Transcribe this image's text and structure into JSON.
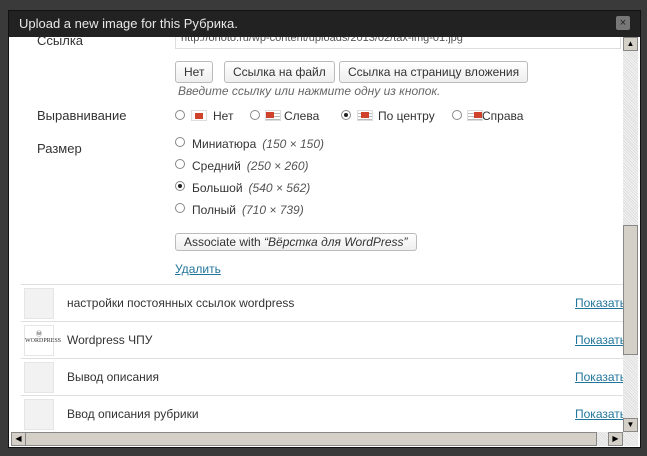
{
  "dialog": {
    "title": "Upload a new image for this Рубрика.",
    "close_icon": "×"
  },
  "link": {
    "label": "Ссылка",
    "url": "http://onoto.ru/wp-content/uploads/2013/02/tax-img-01.jpg",
    "buttons": [
      "Нет",
      "Ссылка на файл",
      "Ссылка на страницу вложения"
    ],
    "hint": "Введите ссылку или нажмите одну из кнопок."
  },
  "align": {
    "label": "Выравнивание",
    "options": [
      {
        "label": "Нет",
        "checked": false
      },
      {
        "label": "Слева",
        "checked": false
      },
      {
        "label": "По центру",
        "checked": true
      },
      {
        "label": "Справа",
        "checked": false
      }
    ]
  },
  "size": {
    "label": "Размер",
    "options": [
      {
        "label": "Миниатюра",
        "dim": "(150 × 150)",
        "checked": false
      },
      {
        "label": "Средний",
        "dim": "(250 × 260)",
        "checked": false
      },
      {
        "label": "Большой",
        "dim": "(540 × 562)",
        "checked": true
      },
      {
        "label": "Полный",
        "dim": "(710 × 739)",
        "checked": false
      }
    ]
  },
  "associate": {
    "prefix": "Associate with ",
    "name": "“Вёрстка для WordPress”"
  },
  "delete_label": "Удалить",
  "items": [
    {
      "title": "настройки постоянных ссылок wordpress",
      "action": "Показать"
    },
    {
      "title": "Wordpress ЧПУ",
      "action": "Показать"
    },
    {
      "title": "Вывод описания",
      "action": "Показать"
    },
    {
      "title": "Ввод описания рубрики",
      "action": "Показать"
    }
  ]
}
